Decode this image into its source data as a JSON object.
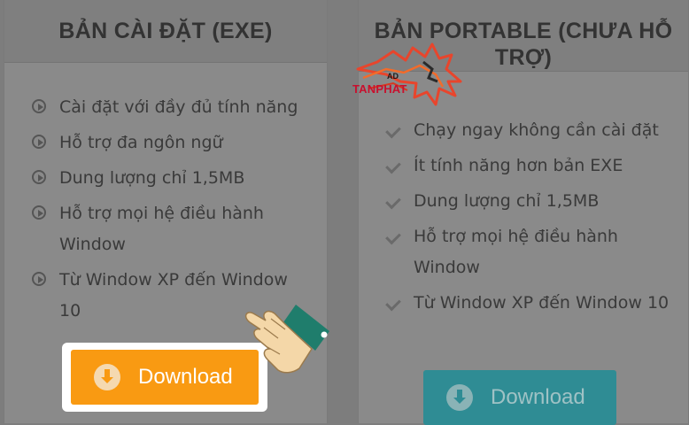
{
  "left_column": {
    "title": "BẢN CÀI ĐẶT (EXE)",
    "features": [
      "Cài đặt với đầy đủ tính năng",
      "Hỗ trợ đa ngôn ngữ",
      "Dung lượng chỉ 1,5MB",
      "Hỗ trợ mọi hệ điều hành Window",
      "Từ Window XP đến Window 10"
    ],
    "download_label": "Download"
  },
  "right_column": {
    "title": "BẢN PORTABLE (CHƯA HỖ TRỢ)",
    "features": [
      "Chạy ngay không cần cài đặt",
      "Ít tính năng hơn bản EXE",
      "Dung lượng chỉ 1,5MB",
      "Hỗ trợ mọi hệ điều hành Window",
      "Từ Window XP đến Window 10"
    ],
    "download_label": "Download"
  },
  "watermark": {
    "ad": "AD",
    "brand": "TANPHAT"
  },
  "colors": {
    "exe_button": "#f99a12",
    "portable_button": "#2f8c94",
    "highlight": "#ffffff"
  },
  "icons": {
    "feature_left": "play-circle-icon",
    "feature_right": "check-icon",
    "download": "download-circle-icon",
    "pointer": "pointing-hand-icon"
  }
}
